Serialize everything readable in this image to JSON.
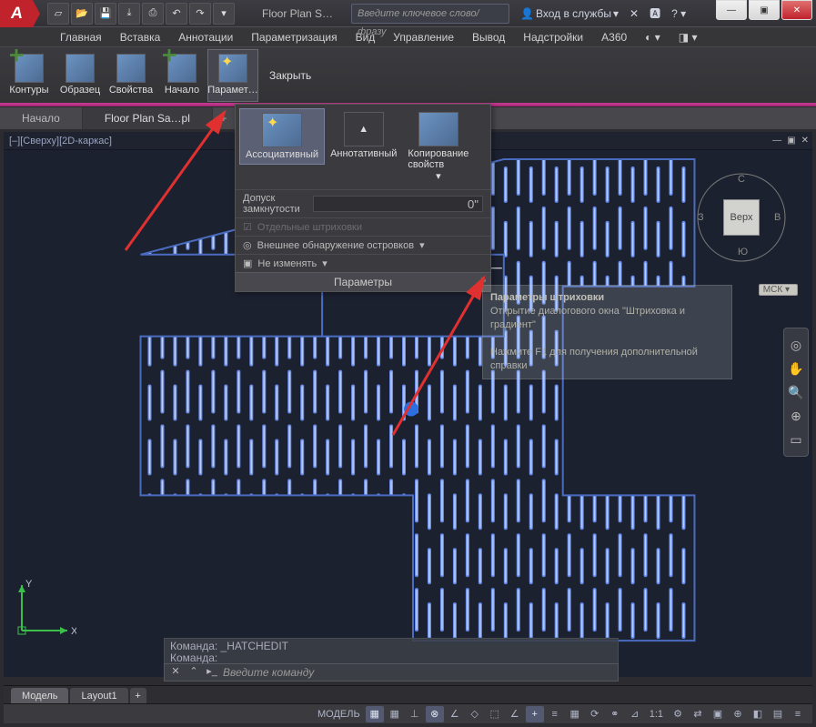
{
  "app": {
    "logo": "A",
    "doc_title": "Floor Plan S…",
    "search_placeholder": "Введите ключевое слово/фразу",
    "signin": "Вход в службы"
  },
  "win": {
    "min": "—",
    "max": "▣",
    "close": "✕"
  },
  "menu": [
    "Главная",
    "Вставка",
    "Аннотации",
    "Параметризация",
    "Вид",
    "Управление",
    "Вывод",
    "Надстройки",
    "A360"
  ],
  "ribbon": {
    "items": [
      {
        "label": "Контуры"
      },
      {
        "label": "Образец"
      },
      {
        "label": "Свойства"
      },
      {
        "label": "Начало"
      },
      {
        "label": "Парамет…",
        "active": true
      }
    ],
    "close": "Закрыть"
  },
  "doctabs": {
    "items": [
      "Начало",
      "Floor Plan Sa…pl"
    ],
    "active": 1
  },
  "vp_label": "[–][Сверху][2D-каркас]",
  "popup": {
    "btns": [
      {
        "label": "Ассоциативный",
        "sel": true
      },
      {
        "label": "Аннотативный"
      },
      {
        "label": "Копирование\nсвойств",
        "arrow": true
      }
    ],
    "gap_label": "Допуск замкнутости",
    "gap_value": "0\"",
    "sep_hatch": "Отдельные штриховки",
    "islands": "Внешнее обнаружение островков",
    "nochange": "Не изменять",
    "bottom": "Параметры"
  },
  "viewcube": {
    "face": "Верх",
    "n": "С",
    "s": "Ю",
    "e": "В",
    "w": "З",
    "wcs": "МСК"
  },
  "tooltip": {
    "title": "Параметры штриховки",
    "line1": "Открытие диалогового окна \"Штриховка и градиент\"",
    "line2": "Нажмите F1 для получения дополнительной справки"
  },
  "cmd": {
    "hist1": "Команда: _HATCHEDIT",
    "hist2": "Команда:",
    "prompt": "Введите команду"
  },
  "ucs": {
    "x": "X",
    "y": "Y"
  },
  "layout": {
    "tabs": [
      "Модель",
      "Layout1"
    ],
    "active": 0,
    "plus": "+"
  },
  "status": {
    "model": "МОДЕЛЬ",
    "scale": "1:1",
    "icons": [
      "▦",
      "▦",
      "⊞",
      "P",
      "⟂",
      "∟",
      "◣",
      "✕",
      "⌖",
      "∴",
      "⟟",
      "▭",
      "1:1",
      "✿",
      "⤢",
      "⇄",
      "▣",
      "⊕",
      "◧",
      "▤",
      "≡"
    ]
  }
}
